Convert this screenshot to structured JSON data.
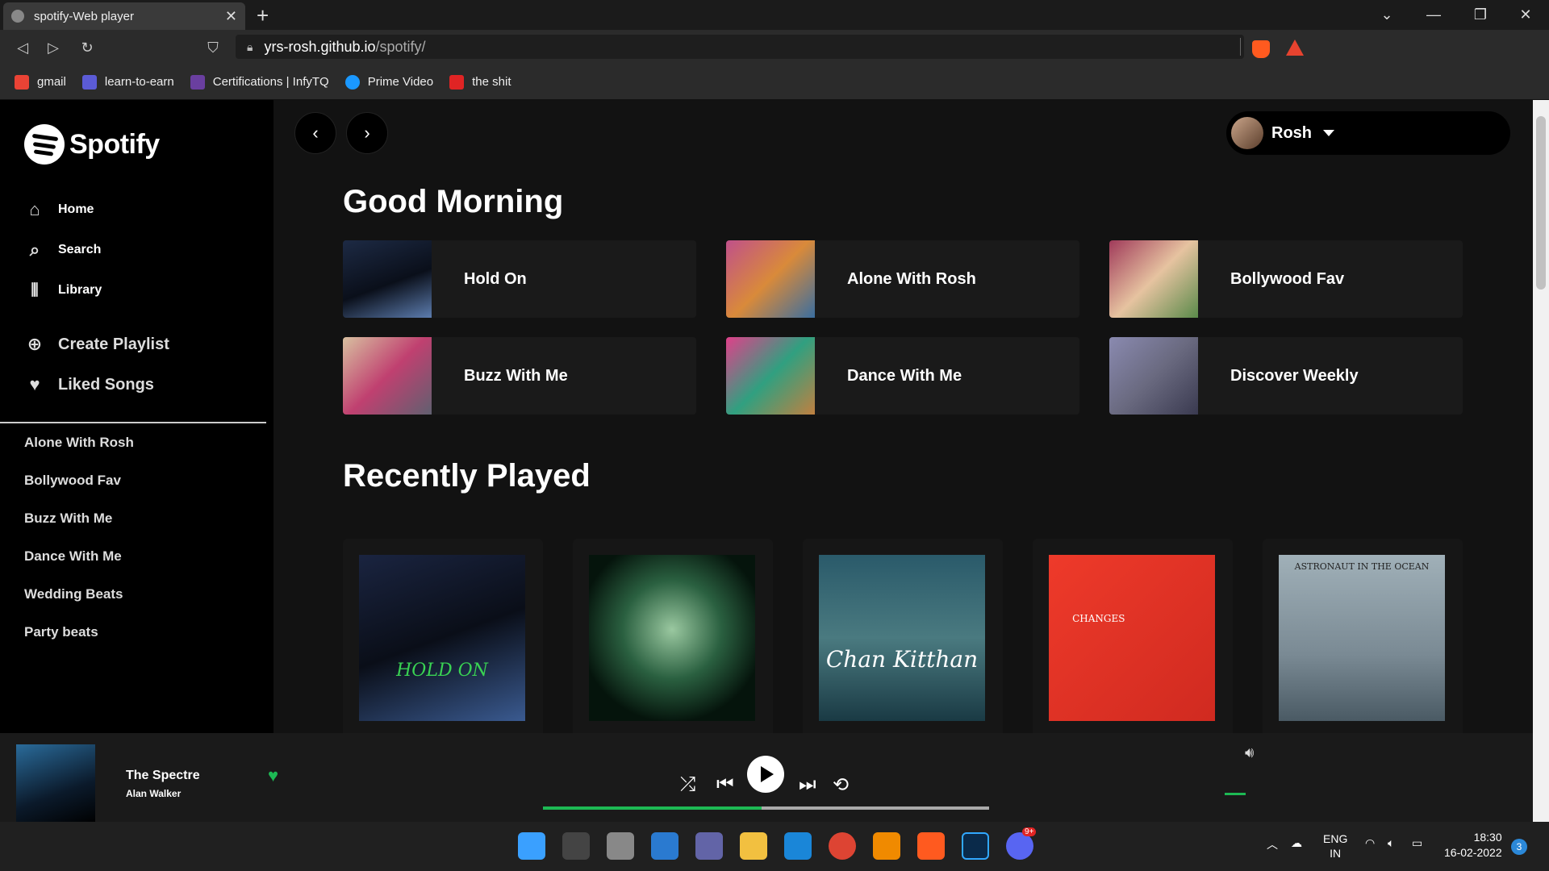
{
  "browser": {
    "tab_title": "spotify-Web player",
    "url_host": "yrs-rosh.github.io",
    "url_path": "/spotify/",
    "bookmarks": [
      {
        "label": "gmail",
        "color": "#ea4335"
      },
      {
        "label": "learn-to-earn",
        "color": "#5b5bd6"
      },
      {
        "label": "Certifications | InfyTQ",
        "color": "#6a3fa0"
      },
      {
        "label": "Prime Video",
        "color": "#1a98ff"
      },
      {
        "label": "the shit",
        "color": "#e02424"
      }
    ]
  },
  "sidebar": {
    "brand": "Spotify",
    "nav": [
      "Home",
      "Search",
      "Library"
    ],
    "actions": [
      "Create Playlist",
      "Liked Songs"
    ],
    "playlists": [
      "Alone With Rosh",
      "Bollywood Fav",
      "Buzz With Me",
      "Dance With Me",
      "Wedding Beats",
      "Party beats"
    ]
  },
  "header": {
    "user_name": "Rosh"
  },
  "main": {
    "greeting": "Good Morning",
    "quick_cards": [
      "Hold On",
      "Alone With Rosh",
      "Bollywood Fav",
      "Buzz With Me",
      "Dance With Me",
      "Discover Weekly"
    ],
    "recent_title": "Recently Played",
    "recent_covers": [
      "HOLD ON",
      "",
      "Chan Kitthan",
      "CHANGES",
      "ASTRONAUT IN THE OCEAN"
    ]
  },
  "player": {
    "title": "The Spectre",
    "artist": "Alan Walker",
    "progress": 0.49,
    "volume_level": 0.1,
    "accent": "#1db954"
  },
  "taskbar": {
    "lang": "ENG",
    "region": "IN",
    "time": "18:30",
    "date": "16-02-2022",
    "notifications": "3",
    "discord_badge": "9+"
  }
}
